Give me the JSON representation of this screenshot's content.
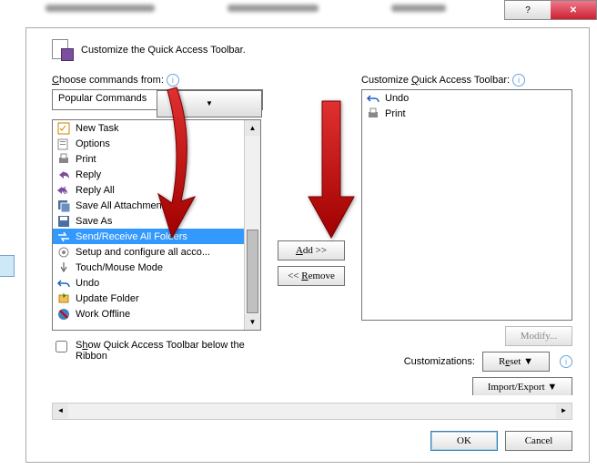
{
  "header": {
    "title": "Customize the Quick Access Toolbar."
  },
  "choose_label": "Choose commands from:",
  "choose_value": "Popular Commands",
  "qat_label": "Customize Quick Access Toolbar:",
  "left_items": [
    {
      "icon": "task",
      "label": "New Task"
    },
    {
      "icon": "options",
      "label": "Options"
    },
    {
      "icon": "print",
      "label": "Print"
    },
    {
      "icon": "reply",
      "label": "Reply"
    },
    {
      "icon": "replyall",
      "label": "Reply All"
    },
    {
      "icon": "saveall",
      "label": "Save All Attachments..."
    },
    {
      "icon": "saveas",
      "label": "Save As"
    },
    {
      "icon": "sendrecv",
      "label": "Send/Receive All Folders",
      "selected": true
    },
    {
      "icon": "setup",
      "label": "Setup and configure all acco..."
    },
    {
      "icon": "touch",
      "label": "Touch/Mouse Mode",
      "submenu": true
    },
    {
      "icon": "undo",
      "label": "Undo"
    },
    {
      "icon": "update",
      "label": "Update Folder"
    },
    {
      "icon": "offline",
      "label": "Work Offline"
    }
  ],
  "right_items": [
    {
      "icon": "undo",
      "label": "Undo"
    },
    {
      "icon": "print",
      "label": "Print"
    }
  ],
  "add_btn": "Add >>",
  "remove_btn": "<< Remove",
  "modify_btn": "Modify...",
  "customizations_label": "Customizations:",
  "reset_btn": "Reset",
  "import_btn": "Import/Export",
  "show_below": "Show Quick Access Toolbar below the Ribbon",
  "ok_btn": "OK",
  "cancel_btn": "Cancel"
}
